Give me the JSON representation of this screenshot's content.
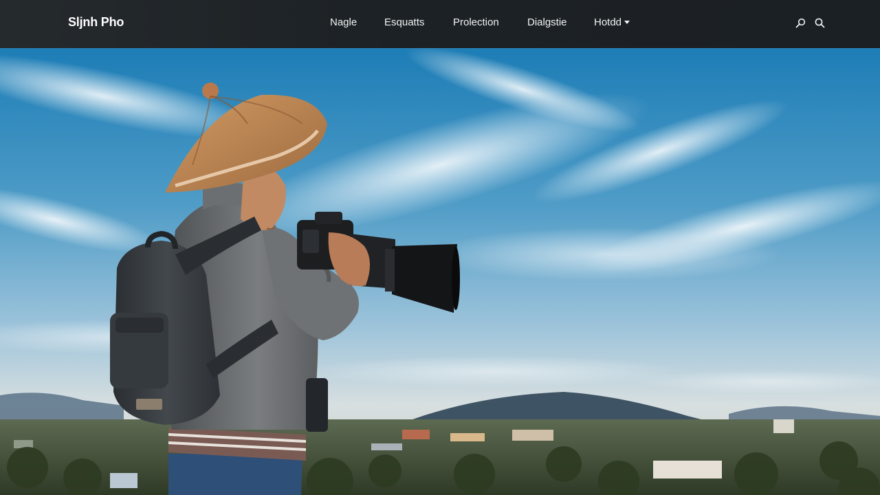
{
  "header": {
    "brand": "Sljnh Pho",
    "nav": [
      {
        "label": "Nagle"
      },
      {
        "label": "Esquatts"
      },
      {
        "label": "Prolection"
      },
      {
        "label": "Dialgstie"
      },
      {
        "label": "Hotdd",
        "has_dropdown": true
      }
    ],
    "icons": [
      "search-icon",
      "magnifier-icon"
    ]
  },
  "colors": {
    "header_bg": "#1c2125",
    "nav_text": "#f1f3f4",
    "sky_top": "#1f7fb5",
    "hat": "#c98a55",
    "jacket": "#6b6e70",
    "backpack": "#3a3f44"
  }
}
